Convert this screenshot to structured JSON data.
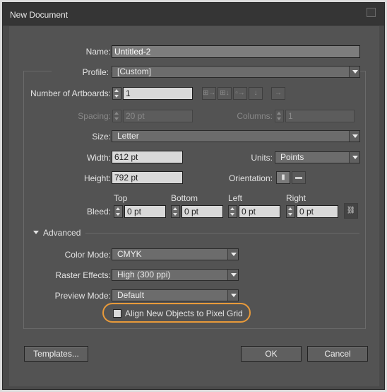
{
  "window": {
    "title": "New Document"
  },
  "name": {
    "label": "Name:",
    "value": "Untitled-2"
  },
  "profile": {
    "label": "Profile:",
    "value": "[Custom]"
  },
  "artboards": {
    "label": "Number of Artboards:",
    "value": "1"
  },
  "spacing": {
    "label": "Spacing:",
    "value": "20 pt"
  },
  "columns": {
    "label": "Columns:",
    "value": "1"
  },
  "size": {
    "label": "Size:",
    "value": "Letter"
  },
  "width": {
    "label": "Width:",
    "value": "612 pt"
  },
  "units": {
    "label": "Units:",
    "value": "Points"
  },
  "height": {
    "label": "Height:",
    "value": "792 pt"
  },
  "orientation": {
    "label": "Orientation:",
    "icons": [
      "portrait-icon",
      "landscape-icon"
    ]
  },
  "bleed": {
    "label": "Bleed:",
    "top": {
      "label": "Top",
      "value": "0 pt"
    },
    "bottom": {
      "label": "Bottom",
      "value": "0 pt"
    },
    "left": {
      "label": "Left",
      "value": "0 pt"
    },
    "right": {
      "label": "Right",
      "value": "0 pt"
    }
  },
  "advanced": {
    "label": "Advanced",
    "color_mode": {
      "label": "Color Mode:",
      "value": "CMYK"
    },
    "raster_effects": {
      "label": "Raster Effects:",
      "value": "High (300 ppi)"
    },
    "preview_mode": {
      "label": "Preview Mode:",
      "value": "Default"
    },
    "pixel_grid": {
      "label": "Align New Objects to Pixel Grid",
      "checked": false
    }
  },
  "buttons": {
    "templates": "Templates...",
    "ok": "OK",
    "cancel": "Cancel"
  },
  "colors": {
    "highlight": "#e89a3a",
    "background": "#535353",
    "titlebar": "#353535"
  }
}
